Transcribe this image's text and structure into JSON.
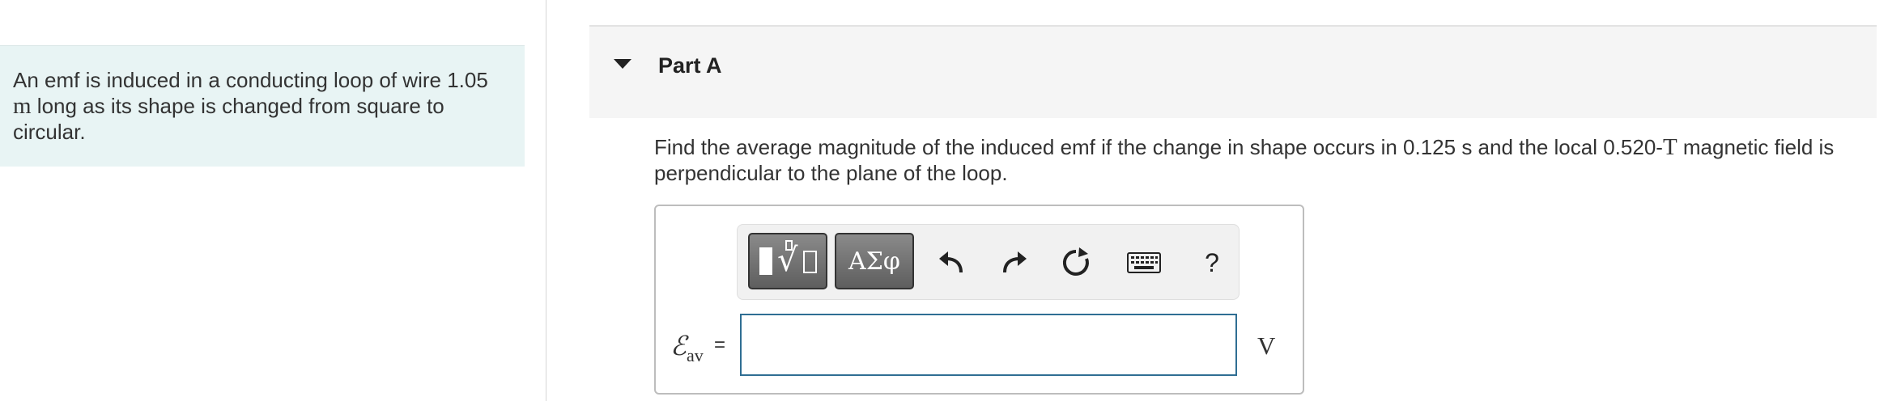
{
  "problem": {
    "intro_part1": "An emf is induced in a conducting loop of wire 1.05",
    "intro_unit": "m",
    "intro_part2": "long as its shape is changed from square to circular."
  },
  "part": {
    "title": "Part A",
    "question_part1": "Find the average magnitude of the induced emf if the change in shape occurs in 0.125 s and the local 0.520-",
    "question_unit": "T",
    "question_part2": "magnetic field is perpendicular to the plane of the loop."
  },
  "toolbar": {
    "greek_label": "ΑΣφ",
    "help_label": "?"
  },
  "answer": {
    "variable_main": "ℰ",
    "variable_sub": "av",
    "equals": "=",
    "value": "",
    "unit": "V"
  },
  "colors": {
    "intro_background": "#e8f4f4",
    "header_background": "#f5f5f5",
    "input_border": "#2f6e93"
  }
}
